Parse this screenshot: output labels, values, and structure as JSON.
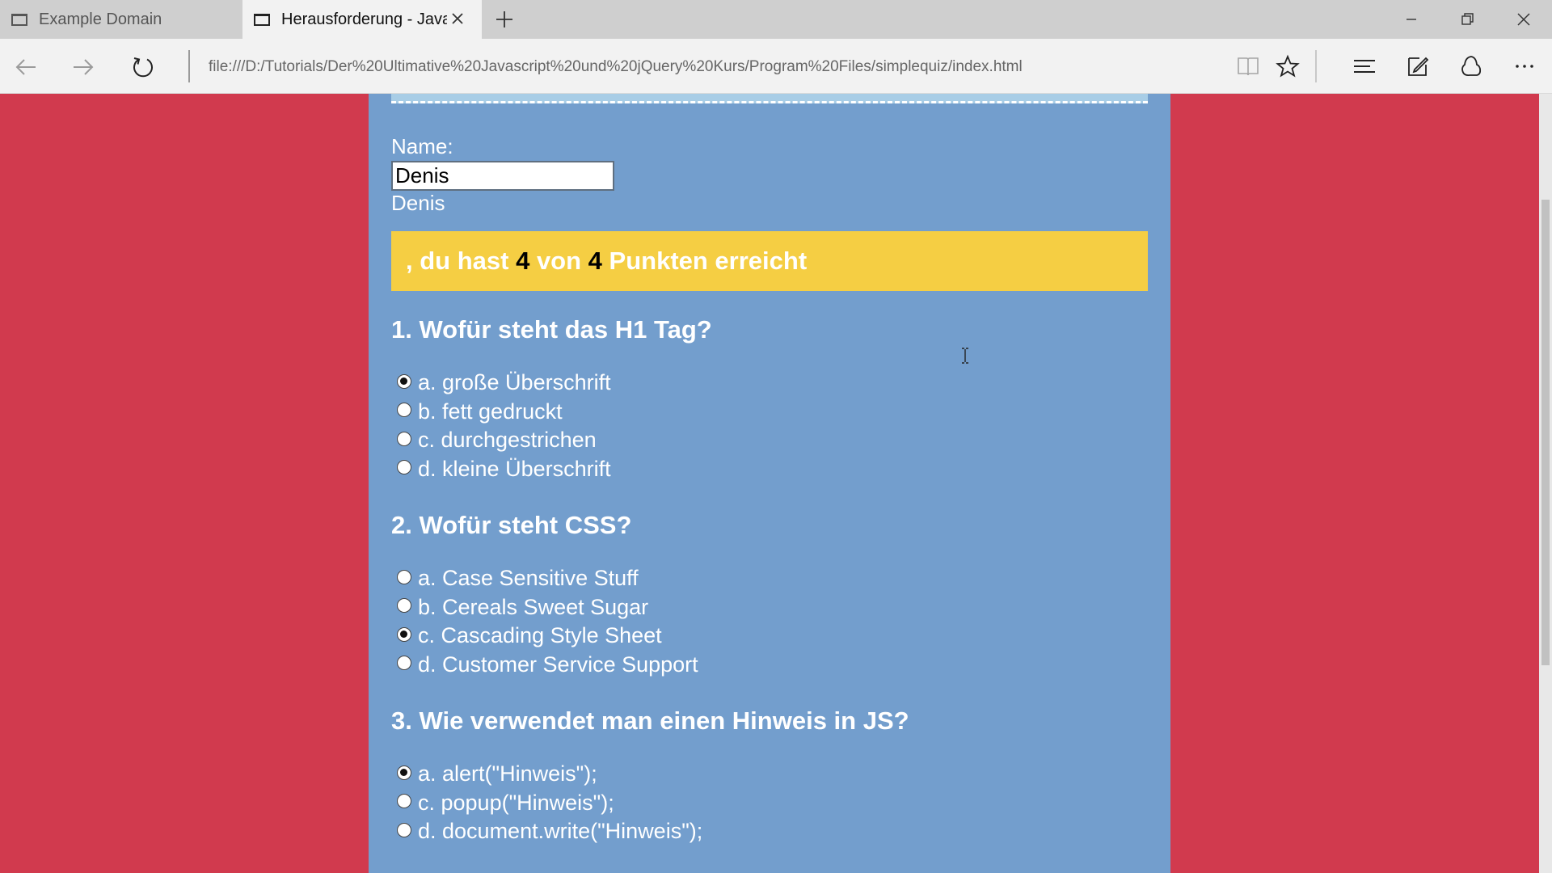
{
  "browser": {
    "tabs": [
      {
        "title": "Example Domain",
        "active": false
      },
      {
        "title": "Herausforderung - Javas",
        "active": true
      }
    ],
    "address": "file:///D:/Tutorials/Der%20Ultimative%20Javascript%20und%20jQuery%20Kurs/Program%20Files/simplequiz/index.html",
    "icons": [
      "tab-page-icon",
      "close-icon",
      "plus-icon",
      "minimize-icon",
      "restore-icon",
      "window-close-icon",
      "back-arrow-icon",
      "forward-arrow-icon",
      "refresh-icon",
      "reading-view-icon",
      "star-icon",
      "hub-icon",
      "web-note-icon",
      "share-icon",
      "more-icon"
    ]
  },
  "page": {
    "name_label": "Name:",
    "name_value": "Denis",
    "name_echo": "Denis",
    "result": {
      "prefix": ", du hast ",
      "score": "4",
      "middle": " von ",
      "total": "4",
      "suffix": " Punkten erreicht"
    },
    "questions": [
      {
        "title": "1. Wofür steht das H1 Tag?",
        "options": [
          {
            "label": "a. große Überschrift",
            "checked": true
          },
          {
            "label": "b. fett gedruckt",
            "checked": false
          },
          {
            "label": "c. durchgestrichen",
            "checked": false
          },
          {
            "label": "d. kleine Überschrift",
            "checked": false
          }
        ]
      },
      {
        "title": "2. Wofür steht CSS?",
        "options": [
          {
            "label": "a. Case Sensitive Stuff",
            "checked": false
          },
          {
            "label": "b. Cereals Sweet Sugar",
            "checked": false
          },
          {
            "label": "c. Cascading Style Sheet",
            "checked": true
          },
          {
            "label": "d. Customer Service Support",
            "checked": false
          }
        ]
      },
      {
        "title": "3. Wie verwendet man einen Hinweis in JS?",
        "options": [
          {
            "label": "a. alert(\"Hinweis\");",
            "checked": true
          },
          {
            "label": "c. popup(\"Hinweis\");",
            "checked": false
          },
          {
            "label": "d. document.write(\"Hinweis\");",
            "checked": false
          }
        ]
      }
    ]
  },
  "colors": {
    "page_background": "#d13a4e",
    "quiz_background": "#739ecd",
    "result_background": "#f5ce43",
    "text": "#ffffff"
  }
}
